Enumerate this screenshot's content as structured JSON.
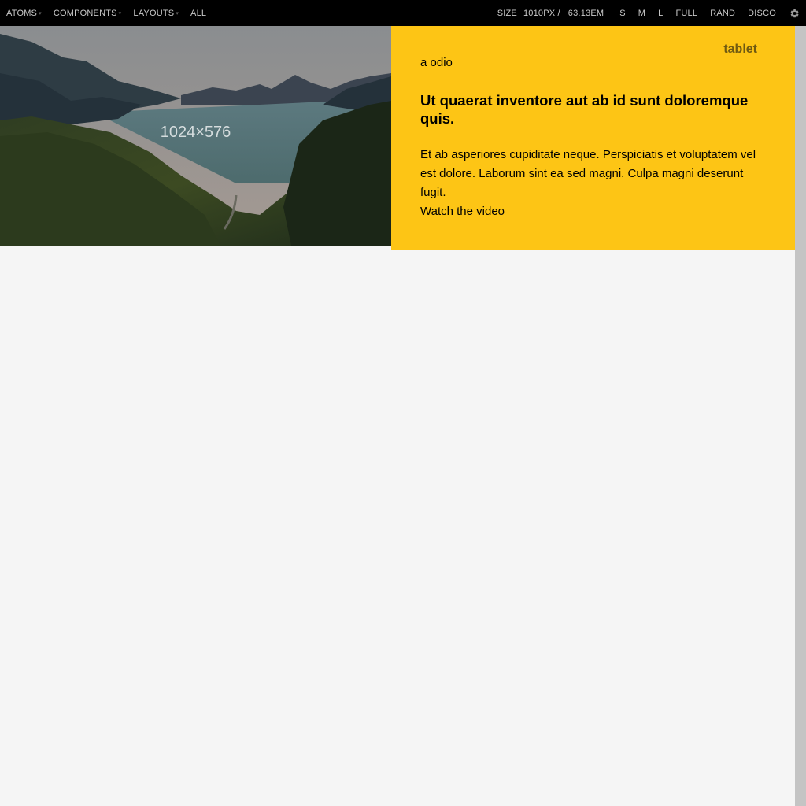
{
  "toolbar": {
    "nav": [
      {
        "label": "ATOMS",
        "has_caret": true
      },
      {
        "label": "COMPONENTS",
        "has_caret": true
      },
      {
        "label": "LAYOUTS",
        "has_caret": true
      },
      {
        "label": "ALL",
        "has_caret": false
      }
    ],
    "size_label": "SIZE",
    "size_px": "1010PX /",
    "size_em": "63.13EM",
    "size_buttons": [
      "S",
      "M",
      "L",
      "FULL",
      "RAND",
      "DISCO"
    ],
    "settings_icon": "gear-icon",
    "caret_icon": "▾"
  },
  "hero": {
    "placeholder_dims": "1024×576"
  },
  "card": {
    "badge": "tablet",
    "kicker": "a odio",
    "headline": "Ut quaerat inventore aut ab id sunt doloremque quis.",
    "body": "Et ab asperiores cupiditate neque. Perspiciatis et voluptatem vel est dolore. Laborum sint ea sed magni. Culpa magni deserunt fugit.",
    "link": "Watch the video",
    "color": "#fdc515"
  },
  "colors": {
    "toolbar_bg": "#000000",
    "page_bg": "#f5f5f5",
    "handle": "#c4c4c4",
    "accent": "#fdc515"
  }
}
